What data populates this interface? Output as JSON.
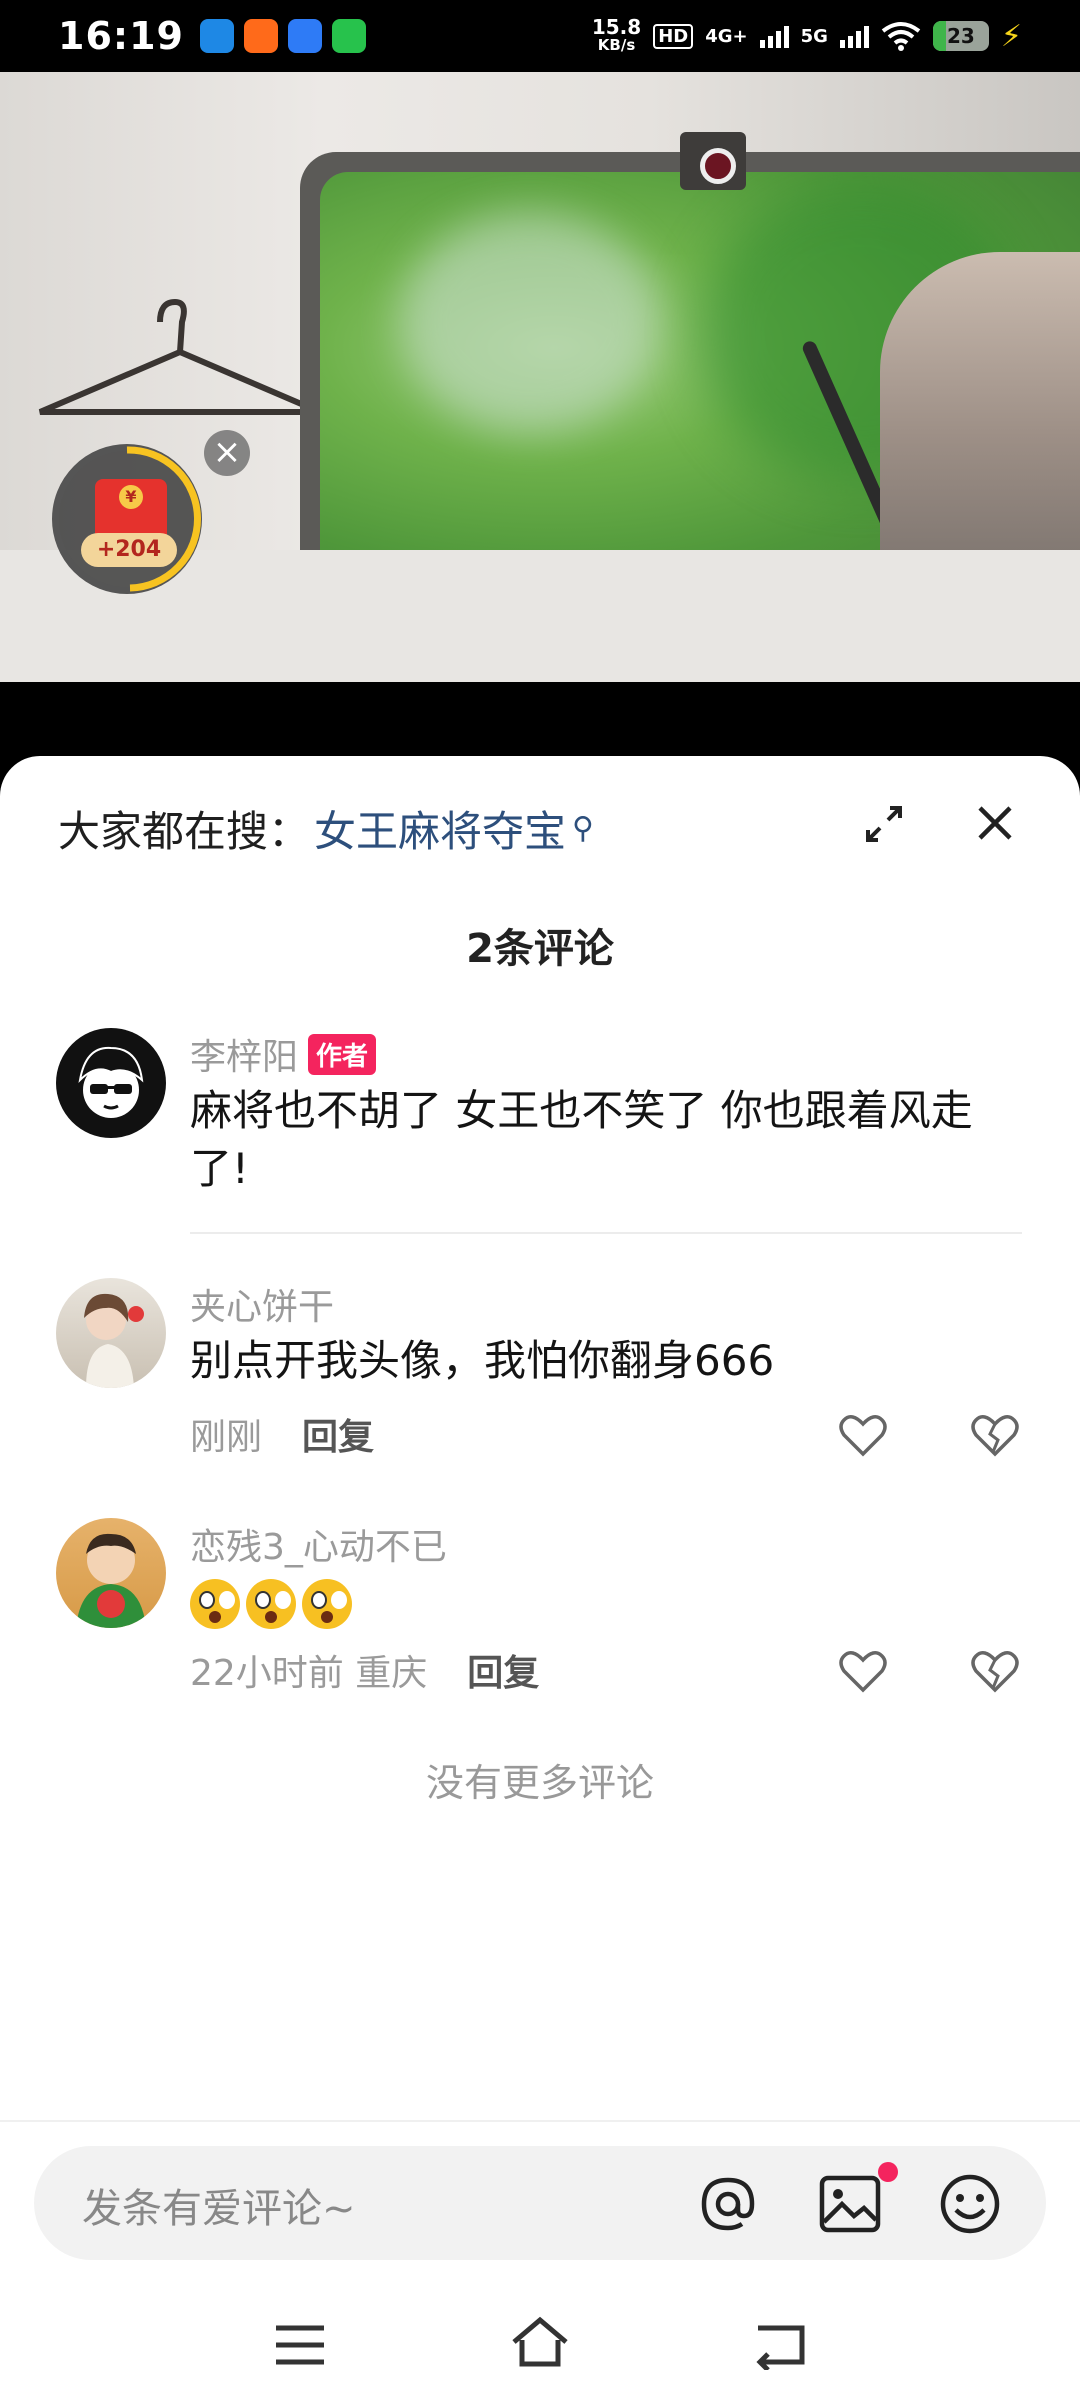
{
  "status_bar": {
    "time": "16:19",
    "net_speed": "15.8",
    "net_unit": "KB/s",
    "hd": "HD",
    "net1": "4G+",
    "net2": "5G",
    "battery": "23"
  },
  "video": {
    "red_packet_amount": "+204"
  },
  "comments_panel": {
    "search_prefix": "大家都在搜：",
    "search_term": "女王麻将夺宝",
    "count_title": "2条评论",
    "comments": [
      {
        "user": "李梓阳",
        "author_tag": "作者",
        "text": "麻将也不胡了 女王也不笑了 你也跟着风走了!"
      },
      {
        "user": "夹心饼干",
        "text": "别点开我头像，我怕你翻身666",
        "time": "刚刚",
        "reply": "回复"
      },
      {
        "user": "恋残3_心动不已",
        "text": "",
        "time": "22小时前 重庆",
        "reply": "回复"
      }
    ],
    "no_more": "没有更多评论",
    "input_placeholder": "发条有爱评论~"
  },
  "colors": {
    "accent": "#f4245e",
    "search_link": "#2d4f7c"
  }
}
